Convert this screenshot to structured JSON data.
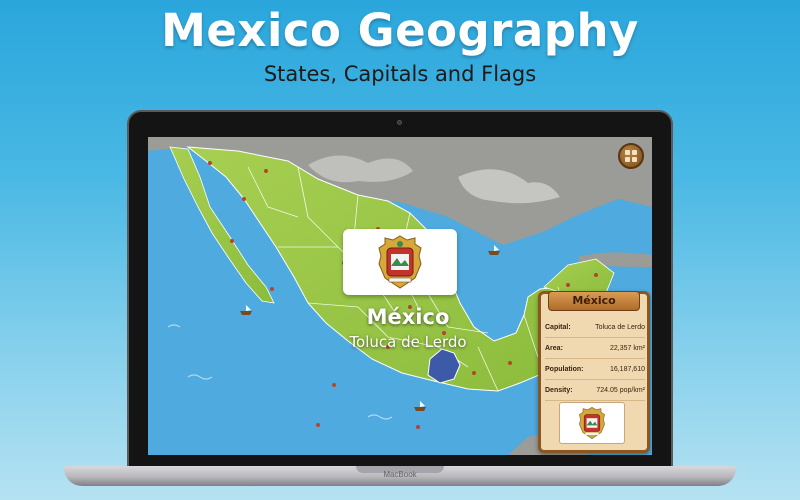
{
  "header": {
    "title": "Mexico Geography",
    "subtitle": "States, Capitals and Flags"
  },
  "device": {
    "brand": "MacBook"
  },
  "map": {
    "selected_state": "México",
    "selected_capital": "Toluca de Lerdo",
    "colors": {
      "ocean": "#4eaadf",
      "land": "#9fc84a",
      "selected_state": "#3d5aa8",
      "border": "#ffffff"
    }
  },
  "info_panel": {
    "title": "México",
    "rows": [
      {
        "label": "Capital:",
        "value": "Toluca de Lerdo"
      },
      {
        "label": "Area:",
        "value": "22,357 km²"
      },
      {
        "label": "Population:",
        "value": "16,187,610"
      },
      {
        "label": "Density:",
        "value": "724.05 pop/km²"
      }
    ]
  },
  "icons": {
    "menu": "grid-menu-icon",
    "coat_of_arms": "coat-of-arms-icon"
  }
}
